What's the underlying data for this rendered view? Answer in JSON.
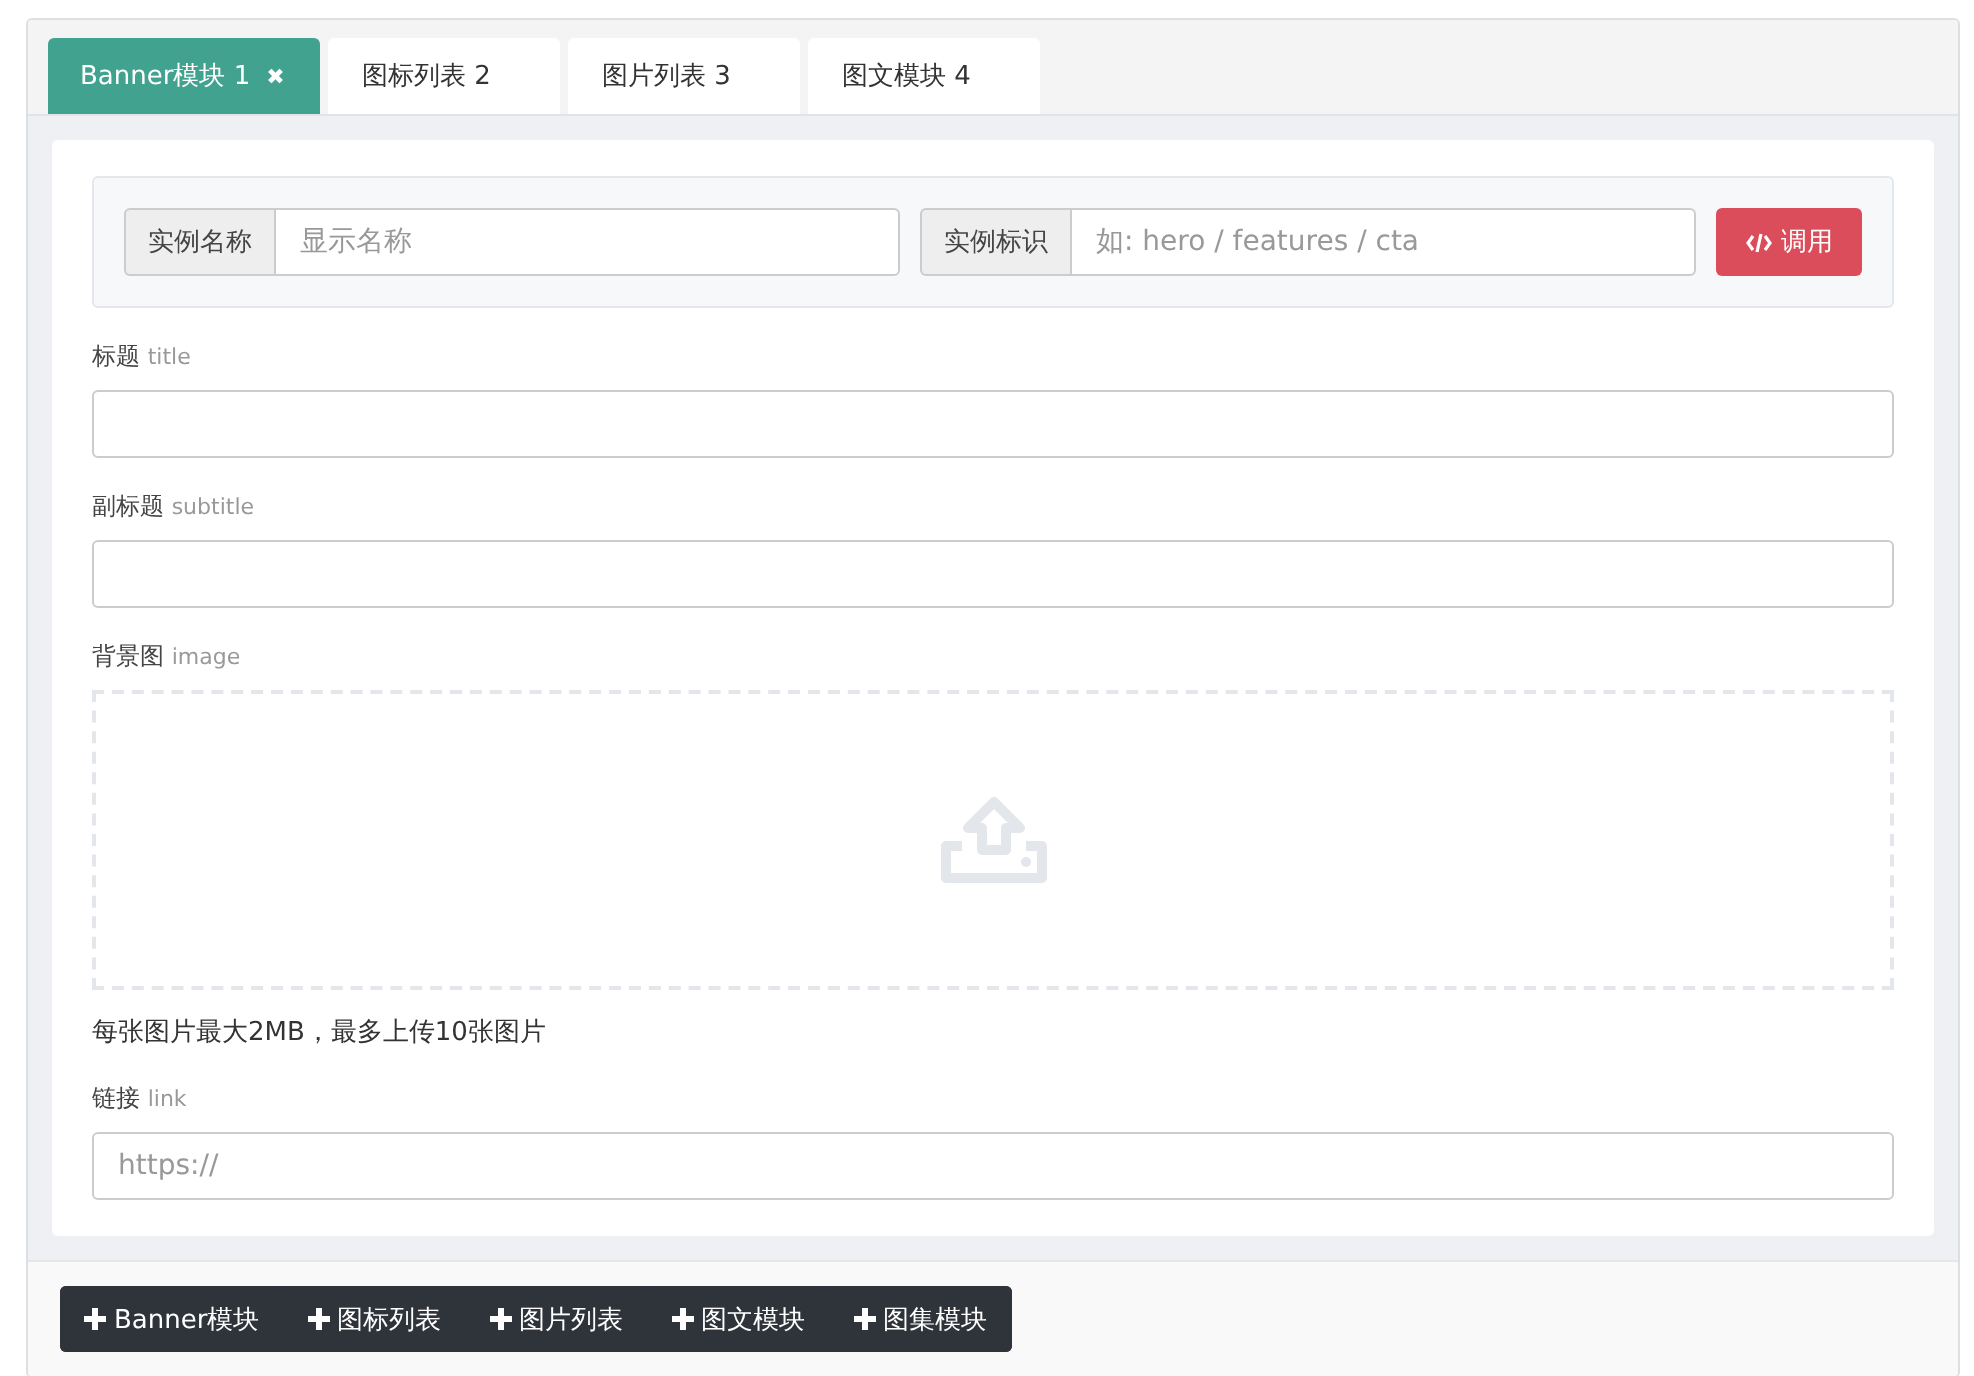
{
  "tabs": [
    {
      "label": "Banner模块 1",
      "selected": true,
      "close": "✖"
    },
    {
      "label": "图标列表 2",
      "selected": false
    },
    {
      "label": "图片列表 3",
      "selected": false
    },
    {
      "label": "图文模块 4",
      "selected": false
    }
  ],
  "instance": {
    "name_label": "实例名称",
    "name_placeholder": "显示名称",
    "id_label": "实例标识",
    "id_placeholder": "如: hero / features / cta",
    "call_button": "调用"
  },
  "fields": [
    {
      "kind": "text",
      "label": "标题",
      "key": "title"
    },
    {
      "kind": "text",
      "label": "副标题",
      "key": "subtitle"
    },
    {
      "kind": "upload",
      "label": "背景图",
      "key": "image",
      "hint": "每张图片最大2MB，最多上传10张图片"
    },
    {
      "kind": "text",
      "label": "链接",
      "key": "link",
      "placeholder": "https://"
    }
  ],
  "add_buttons": [
    "Banner模块",
    "图标列表",
    "图片列表",
    "图文模块",
    "图集模块"
  ]
}
